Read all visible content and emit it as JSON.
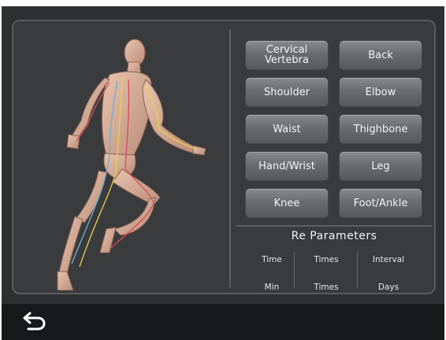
{
  "body_parts": [
    {
      "label": "Cervical\nVertebra"
    },
    {
      "label": "Back"
    },
    {
      "label": "Shoulder"
    },
    {
      "label": "Elbow"
    },
    {
      "label": "Waist"
    },
    {
      "label": "Thighbone"
    },
    {
      "label": "Hand/Wrist"
    },
    {
      "label": "Leg"
    },
    {
      "label": "Knee"
    },
    {
      "label": "Foot/Ankle"
    }
  ],
  "params": {
    "title": "Re Parameters",
    "columns": [
      {
        "header": "Time",
        "unit": "Min"
      },
      {
        "header": "Times",
        "unit": "Times"
      },
      {
        "header": "Interval",
        "unit": "Days"
      }
    ]
  },
  "footer": {
    "back_icon": "back-arrow-icon"
  },
  "colors": {
    "background": "#2f3032",
    "panel": "#3a3b3d",
    "button": "#6b6c6e",
    "bottom_bar": "#18191a"
  }
}
